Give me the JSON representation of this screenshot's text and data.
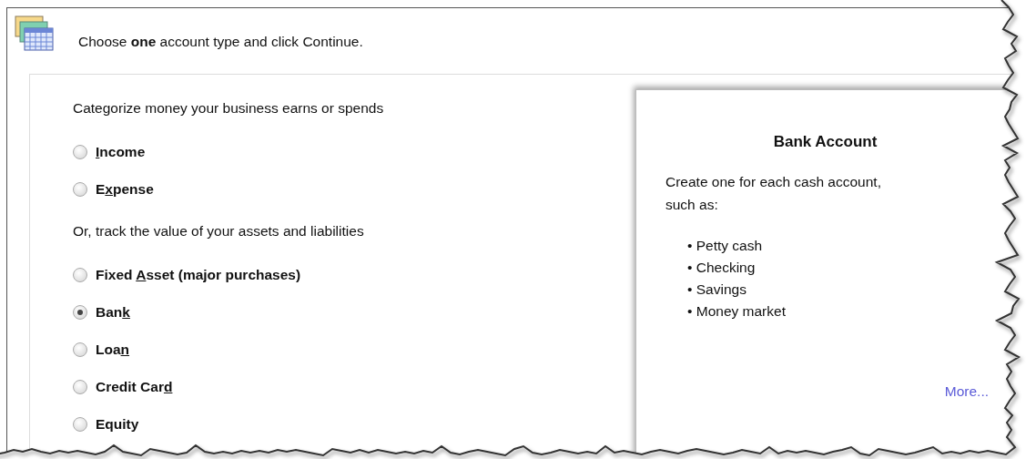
{
  "header": {
    "title": "Choose **one** account type and click Continue."
  },
  "groups": [
    {
      "heading": "Categorize money your business earns or spends",
      "options": [
        {
          "access_key": "I",
          "label_end": "ncome",
          "selected": false
        },
        {
          "label_start": "E",
          "access_key": "x",
          "label_end": "pense",
          "selected": false
        }
      ]
    },
    {
      "heading": "Or, track the value of your assets and liabilities",
      "options": [
        {
          "label_start": "Fixed ",
          "access_key": "A",
          "label_end": "sset (major purchases)",
          "selected": false
        },
        {
          "label_start": "Ban",
          "access_key": "k",
          "selected": true
        },
        {
          "label_start": "Loa",
          "access_key": "n",
          "selected": false
        },
        {
          "label_start": "Credit Car",
          "access_key": "d",
          "selected": false
        },
        {
          "label_start": "Equity",
          "selected": false
        }
      ]
    }
  ],
  "info": {
    "title": "Bank Account",
    "description": "Create one for each cash account, such as:",
    "examples": [
      "• Petty cash",
      "• Checking",
      "• Savings",
      "• Money market"
    ],
    "link": "More..."
  }
}
